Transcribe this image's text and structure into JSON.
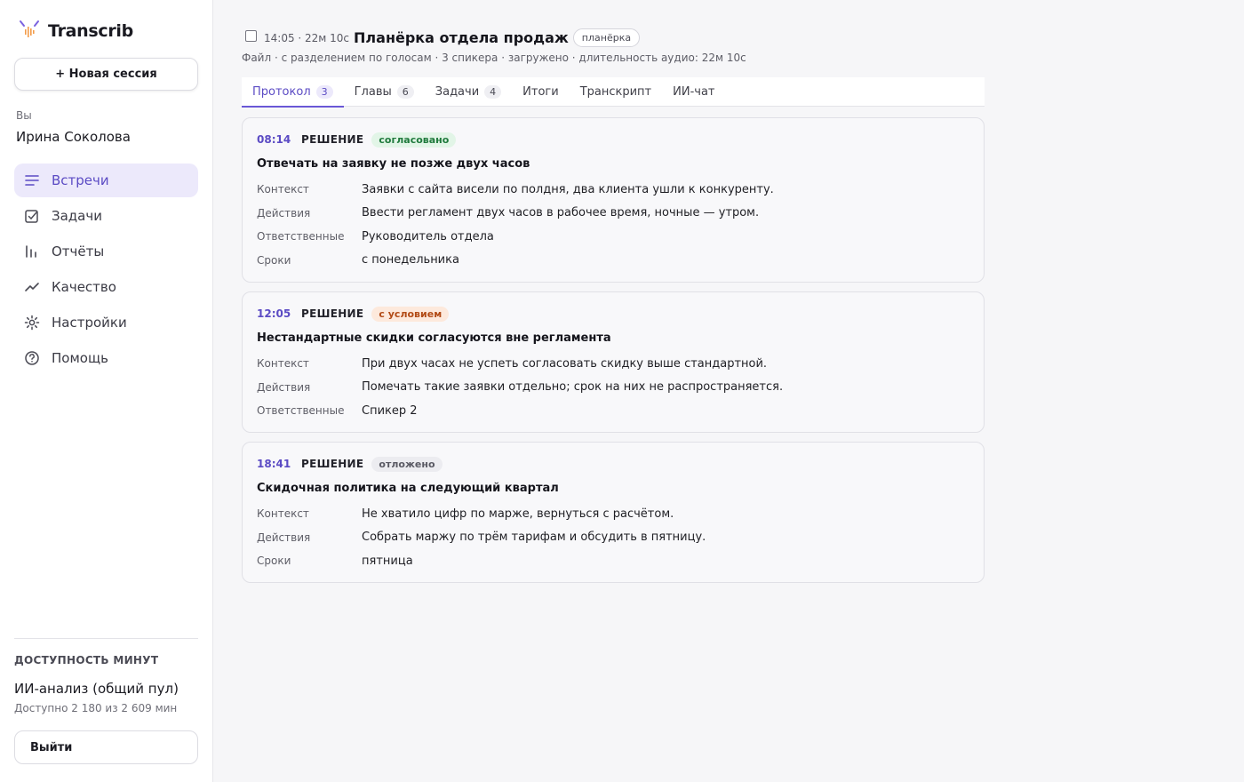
{
  "sidebar": {
    "brand": "Transcrib",
    "new_session": "+ Новая сессия",
    "you_label": "Вы",
    "user_name": "Ирина Соколова",
    "nav": [
      {
        "label": "Встречи",
        "icon": "list-icon"
      },
      {
        "label": "Задачи",
        "icon": "checkbox-icon"
      },
      {
        "label": "Отчёты",
        "icon": "bars-icon"
      },
      {
        "label": "Качество",
        "icon": "trend-icon"
      },
      {
        "label": "Настройки",
        "icon": "gear-icon"
      },
      {
        "label": "Помощь",
        "icon": "help-icon"
      }
    ],
    "minutes_title": "ДОСТУПНОСТЬ МИНУТ",
    "minutes_pool": "ИИ-анализ (общий пул)",
    "minutes_available": "Доступно 2 180 из 2 609 мин",
    "logout": "Выйти"
  },
  "header": {
    "meta": "14:05 · 22м 10с",
    "title": "Планёрка отдела продаж",
    "tag": "планёрка",
    "subline": "Файл · с разделением по голосам · 3 спикера · загружено · длительность аудио: 22м 10с"
  },
  "tabs": [
    {
      "label": "Протокол",
      "count": "3"
    },
    {
      "label": "Главы",
      "count": "6"
    },
    {
      "label": "Задачи",
      "count": "4"
    },
    {
      "label": "Итоги",
      "count": ""
    },
    {
      "label": "Транскрипт",
      "count": ""
    },
    {
      "label": "ИИ-чат",
      "count": ""
    }
  ],
  "decisions": [
    {
      "time": "08:14",
      "kind": "РЕШЕНИЕ",
      "status": "согласовано",
      "title": "Отвечать на заявку не позже двух часов",
      "rows": [
        {
          "label": "Контекст",
          "value": "Заявки с сайта висели по полдня, два клиента ушли к конкуренту."
        },
        {
          "label": "Действия",
          "value": "Ввести регламент двух часов в рабочее время, ночные — утром."
        },
        {
          "label": "Ответственные",
          "value": "Руководитель отдела"
        },
        {
          "label": "Сроки",
          "value": "с понедельника"
        }
      ]
    },
    {
      "time": "12:05",
      "kind": "РЕШЕНИЕ",
      "status": "с условием",
      "title": "Нестандартные скидки согласуются вне регламента",
      "rows": [
        {
          "label": "Контекст",
          "value": "При двух часах не успеть согласовать скидку выше стандартной."
        },
        {
          "label": "Действия",
          "value": "Помечать такие заявки отдельно; срок на них не распространяется."
        },
        {
          "label": "Ответственные",
          "value": "Спикер 2"
        }
      ]
    },
    {
      "time": "18:41",
      "kind": "РЕШЕНИЕ",
      "status": "отложено",
      "title": "Скидочная политика на следующий квартал",
      "rows": [
        {
          "label": "Контекст",
          "value": "Не хватило цифр по марже, вернуться с расчётом."
        },
        {
          "label": "Действия",
          "value": "Собрать маржу по трём тарифам и обсудить в пятницу."
        },
        {
          "label": "Сроки",
          "value": "пятница"
        }
      ]
    }
  ],
  "colors": {
    "accent": "#5b4bc4",
    "status_green": "#1f7a3c",
    "status_orange": "#b24a15",
    "status_gray": "#5a5a64"
  }
}
